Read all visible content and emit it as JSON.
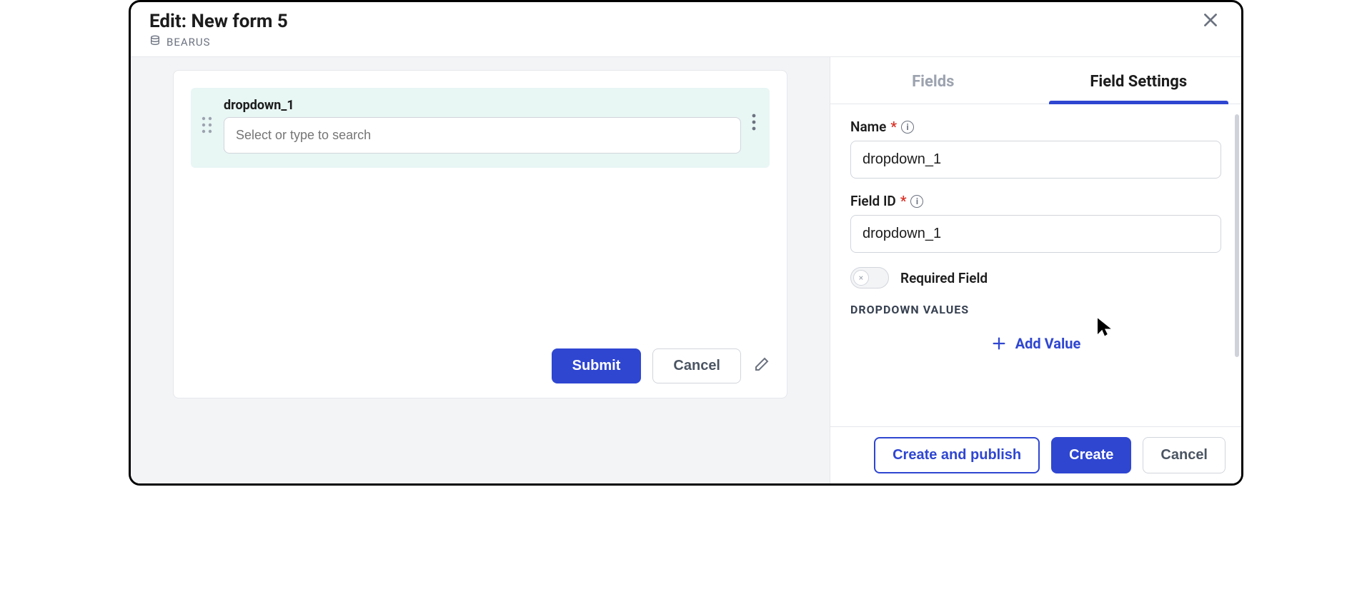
{
  "header": {
    "title": "Edit: New form 5",
    "database": "BEARUS"
  },
  "canvas": {
    "field": {
      "label": "dropdown_1",
      "placeholder": "Select or type to search"
    },
    "submit_label": "Submit",
    "cancel_label": "Cancel"
  },
  "tabs": {
    "fields": "Fields",
    "field_settings": "Field Settings"
  },
  "settings": {
    "name_label": "Name",
    "name_value": "dropdown_1",
    "field_id_label": "Field ID",
    "field_id_value": "dropdown_1",
    "required_label": "Required Field",
    "dropdown_values_heading": "DROPDOWN VALUES",
    "add_value_label": "Add Value"
  },
  "footer": {
    "create_publish": "Create and publish",
    "create": "Create",
    "cancel": "Cancel"
  }
}
